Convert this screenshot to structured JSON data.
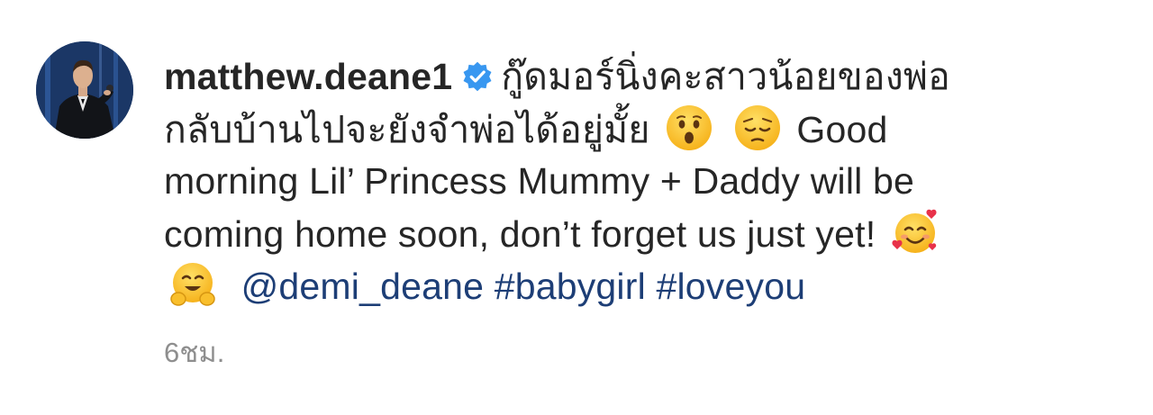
{
  "post": {
    "username": "matthew.deane1",
    "caption": {
      "thai_line1": "กู๊ดมอร์นิ่งคะสาวน้อยของพ่อ",
      "thai_line2": "กลับบ้านไปจะยังจำพ่อได้อยู่มั้ย",
      "english_part1": "Good",
      "english_line3": "morning Lil’ Princess Mummy + Daddy will be",
      "english_line4": "coming home soon, don’t forget us just yet!",
      "mention": "@demi_deane",
      "hashtags": [
        "#babygirl",
        "#loveyou"
      ]
    },
    "timestamp": "6ชม."
  },
  "icons": {
    "avatar": "profile-photo",
    "verified": "verified-badge-icon",
    "emoji_1": "hushed-face-emoji",
    "emoji_2": "pensive-face-emoji",
    "emoji_3": "smiling-face-with-hearts-emoji",
    "emoji_4": "hugging-face-emoji"
  },
  "colors": {
    "text": "#262626",
    "link": "#1d3e76",
    "verified": "#3897f0",
    "timestamp": "#8e8e8e"
  }
}
